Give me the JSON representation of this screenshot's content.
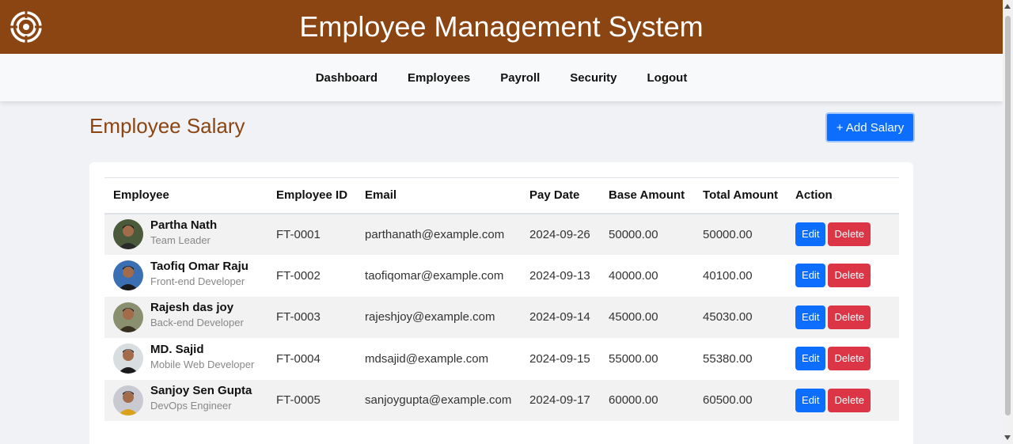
{
  "app": {
    "title": "Employee Management System"
  },
  "nav": [
    "Dashboard",
    "Employees",
    "Payroll",
    "Security",
    "Logout"
  ],
  "page": {
    "title": "Employee Salary",
    "add_button": "+ Add Salary"
  },
  "table": {
    "headers": [
      "Employee",
      "Employee ID",
      "Email",
      "Pay Date",
      "Base Amount",
      "Total Amount",
      "Action"
    ],
    "rows": [
      {
        "name": "Partha Nath",
        "role": "Team Leader",
        "id": "FT-0001",
        "email": "parthanath@example.com",
        "pay_date": "2024-09-26",
        "base": "50000.00",
        "total": "50000.00",
        "edit": "Edit",
        "delete": "Delete"
      },
      {
        "name": "Taofiq Omar Raju",
        "role": "Front-end Developer",
        "id": "FT-0002",
        "email": "taofiqomar@example.com",
        "pay_date": "2024-09-13",
        "base": "40000.00",
        "total": "40100.00",
        "edit": "Edit",
        "delete": "Delete"
      },
      {
        "name": "Rajesh das joy",
        "role": "Back-end Developer",
        "id": "FT-0003",
        "email": "rajeshjoy@example.com",
        "pay_date": "2024-09-14",
        "base": "45000.00",
        "total": "45030.00",
        "edit": "Edit",
        "delete": "Delete"
      },
      {
        "name": "MD. Sajid",
        "role": "Mobile Web Developer",
        "id": "FT-0004",
        "email": "mdsajid@example.com",
        "pay_date": "2024-09-15",
        "base": "55000.00",
        "total": "55380.00",
        "edit": "Edit",
        "delete": "Delete"
      },
      {
        "name": "Sanjoy Sen Gupta",
        "role": "DevOps Engineer",
        "id": "FT-0005",
        "email": "sanjoygupta@example.com",
        "pay_date": "2024-09-17",
        "base": "60000.00",
        "total": "60500.00",
        "edit": "Edit",
        "delete": "Delete"
      }
    ]
  },
  "colors": {
    "header": "#8b4513",
    "primary": "#0d6efd",
    "danger": "#dc3545",
    "title": "#8b4513"
  },
  "icons": {
    "logo": "target-logo-icon",
    "avatar": "user-avatar-icon"
  }
}
